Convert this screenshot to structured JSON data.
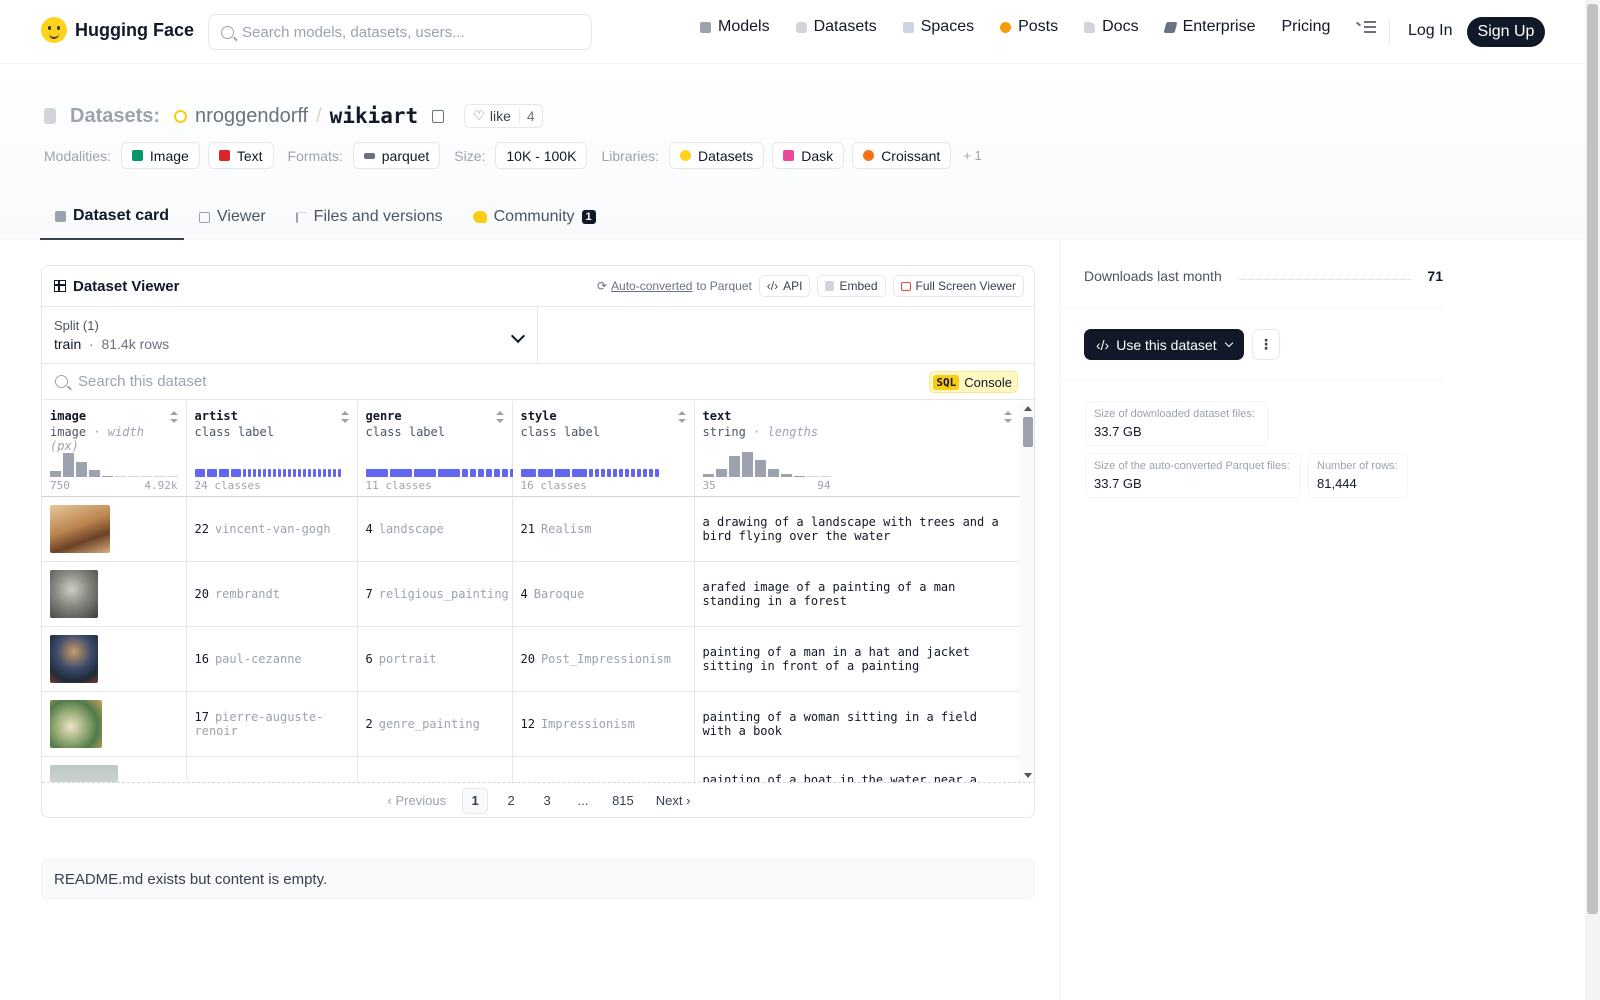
{
  "nav": {
    "logo_text": "Hugging Face",
    "search_placeholder": "Search models, datasets, users...",
    "links": [
      "Models",
      "Datasets",
      "Spaces",
      "Posts",
      "Docs",
      "Enterprise",
      "Pricing"
    ],
    "login": "Log In",
    "signup": "Sign Up"
  },
  "header": {
    "crumb": "Datasets:",
    "owner": "nroggendorff",
    "slash": "/",
    "repo": "wikiart",
    "like_label": "like",
    "like_count": "4",
    "modalities_label": "Modalities:",
    "modalities": [
      "Image",
      "Text"
    ],
    "formats_label": "Formats:",
    "format": "parquet",
    "size_label": "Size:",
    "size": "10K - 100K",
    "libraries_label": "Libraries:",
    "libraries": [
      "Datasets",
      "Dask",
      "Croissant"
    ],
    "more_libraries": "+ 1",
    "tabs": [
      "Dataset card",
      "Viewer",
      "Files and versions",
      "Community"
    ],
    "community_badge": "1"
  },
  "viewer": {
    "title": "Dataset Viewer",
    "auto_converted": "Auto-converted",
    "to_parquet": "to Parquet",
    "api": "API",
    "embed": "Embed",
    "fullscreen": "Full Screen Viewer",
    "split_label": "Split (1)",
    "split_name": "train",
    "split_sep": "·",
    "split_rows": "81.4k rows",
    "search_placeholder": "Search this dataset",
    "sql_tag": "SQL",
    "sql_label": "Console",
    "columns": [
      {
        "name": "image",
        "type": "image",
        "type_extra": "· width (px)",
        "min": "750",
        "max": "4.92k",
        "hist": [
          0.2,
          0.85,
          0.55,
          0.25,
          0.05,
          0.03,
          0.03,
          0.02,
          0.02,
          0.02
        ]
      },
      {
        "name": "artist",
        "type": "class label",
        "classes": "24 classes"
      },
      {
        "name": "genre",
        "type": "class label",
        "classes": "11 classes"
      },
      {
        "name": "style",
        "type": "class label",
        "classes": "16 classes"
      },
      {
        "name": "text",
        "type": "string",
        "type_extra": "· lengths",
        "min": "35",
        "max": "94",
        "hist": [
          0.1,
          0.3,
          0.75,
          0.9,
          0.6,
          0.3,
          0.12,
          0.05,
          0.03,
          0.02
        ]
      }
    ],
    "rows": [
      {
        "artist_id": "22",
        "artist": "vincent-van-gogh",
        "genre_id": "4",
        "genre": "landscape",
        "style_id": "21",
        "style": "Realism",
        "text": "a drawing of a landscape with trees and a bird flying over the water"
      },
      {
        "artist_id": "20",
        "artist": "rembrandt",
        "genre_id": "7",
        "genre": "religious_painting",
        "style_id": "4",
        "style": "Baroque",
        "text": "arafed image of a painting of a man standing in a forest"
      },
      {
        "artist_id": "16",
        "artist": "paul-cezanne",
        "genre_id": "6",
        "genre": "portrait",
        "style_id": "20",
        "style": "Post_Impressionism",
        "text": "painting of a man in a hat and jacket sitting in front of a painting"
      },
      {
        "artist_id": "17",
        "artist": "pierre-auguste-renoir",
        "genre_id": "2",
        "genre": "genre_painting",
        "style_id": "12",
        "style": "Impressionism",
        "text": "painting of a woman sitting in a field with a book"
      },
      {
        "artist_id": "",
        "artist": "",
        "genre_id": "",
        "genre": "",
        "style_id": "",
        "style": "",
        "text": "painting of a boat in the water near a"
      }
    ],
    "pager": {
      "previous": "Previous",
      "pages": [
        "1",
        "2",
        "3",
        "...",
        "815"
      ],
      "next": "Next"
    }
  },
  "readme": "README.md exists but content is empty.",
  "sidebar": {
    "downloads_label": "Downloads last month",
    "downloads_value": "71",
    "use_button": "Use this dataset",
    "stats": [
      {
        "label": "Size of downloaded dataset files:",
        "value": "33.7 GB"
      },
      {
        "label": "Size of the auto-converted Parquet files:",
        "value": "33.7 GB"
      },
      {
        "label": "Number of rows:",
        "value": "81,444"
      }
    ]
  },
  "colors": {
    "accent_bar": "#6366f1",
    "brand_yellow": "#ffd21e",
    "dark": "#111827"
  }
}
